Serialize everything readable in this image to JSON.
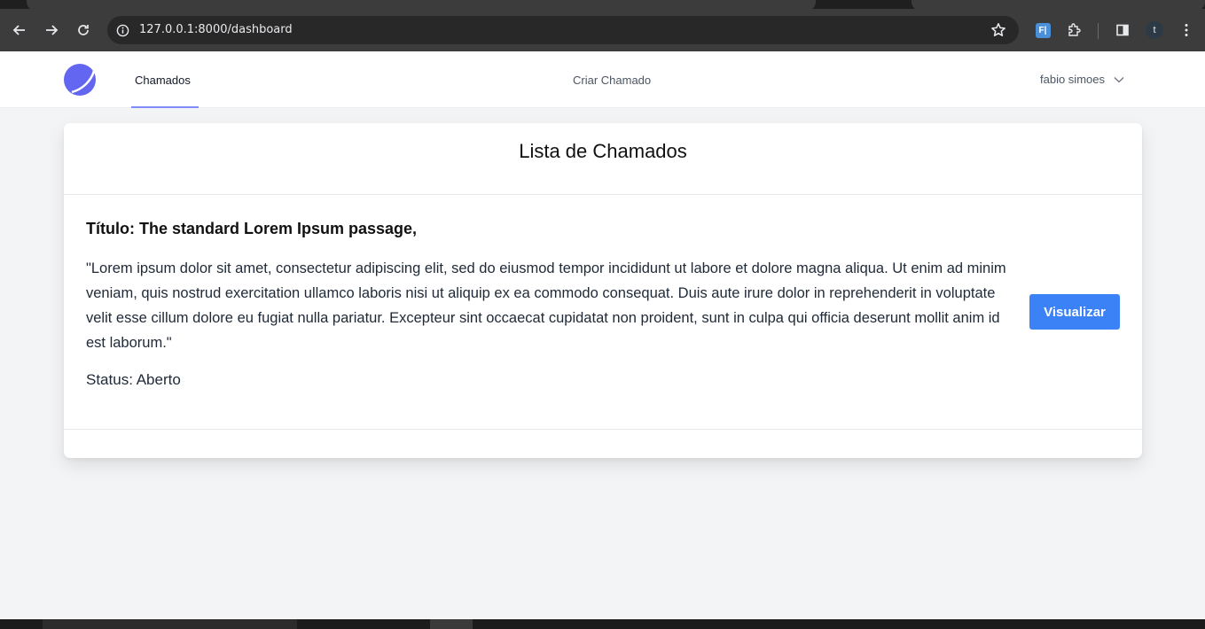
{
  "browser": {
    "url": "127.0.0.1:8000/dashboard",
    "profile_initial": "t",
    "extension_label": "F|"
  },
  "nav": {
    "links": [
      "Chamados",
      "Criar Chamado"
    ],
    "user_name": "fabio simoes"
  },
  "page": {
    "title": "Lista de Chamados",
    "tickets": [
      {
        "title": "Título: The standard Lorem Ipsum passage,",
        "description": "\"Lorem ipsum dolor sit amet, consectetur adipiscing elit, sed do eiusmod tempor incididunt ut labore et dolore magna aliqua. Ut enim ad minim veniam, quis nostrud exercitation ullamco laboris nisi ut aliquip ex ea commodo consequat. Duis aute irure dolor in reprehenderit in voluptate velit esse cillum dolore eu fugiat nulla pariatur. Excepteur sint occaecat cupidatat non proident, sunt in culpa qui officia deserunt mollit anim id est laborum.\"",
        "status": "Status: Aberto",
        "action_label": "Visualizar"
      }
    ]
  },
  "colors": {
    "accent": "#3b82f6",
    "nav_indicator": "#818cf8",
    "logo": "#6366f1"
  },
  "icons": [
    "back-icon",
    "forward-icon",
    "reload-icon",
    "site-info-icon",
    "bookmark-star-icon",
    "extension-icon",
    "puzzle-icon",
    "sidepanel-icon",
    "menu-dots-icon",
    "chevron-down-icon",
    "app-logo"
  ]
}
